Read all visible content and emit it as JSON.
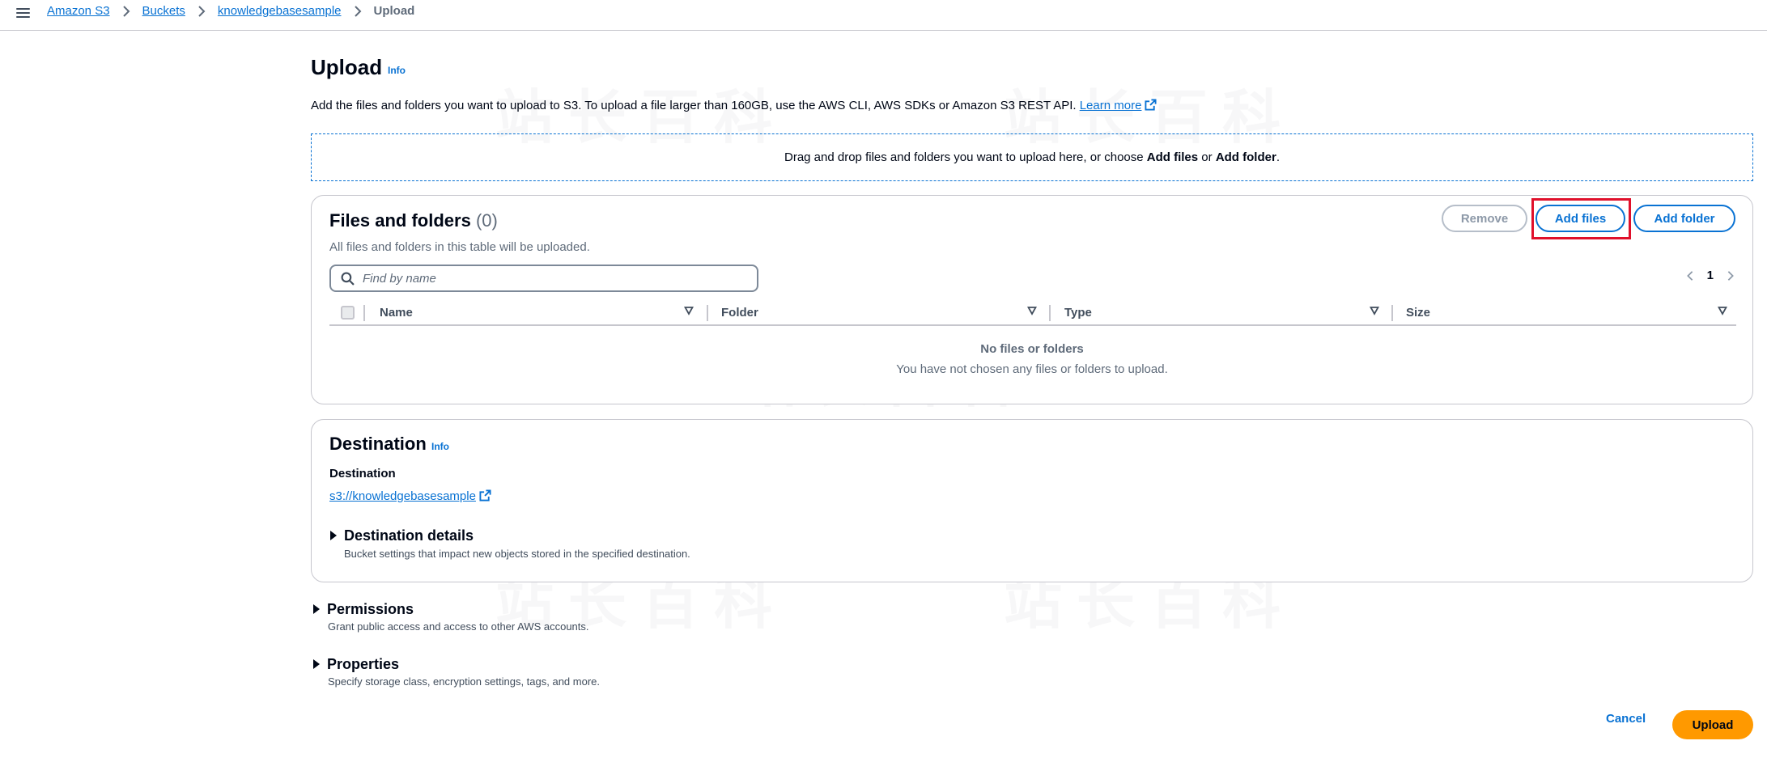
{
  "breadcrumb": {
    "items": [
      "Amazon S3",
      "Buckets",
      "knowledgebasesample"
    ],
    "current": "Upload"
  },
  "page": {
    "title": "Upload",
    "info": "Info",
    "description": "Add the files and folders you want to upload to S3. To upload a file larger than 160GB, use the AWS CLI, AWS SDKs or Amazon S3 REST API.",
    "learn_more": "Learn more"
  },
  "dropzone": {
    "text_before": "Drag and drop files and folders you want to upload here, or choose ",
    "add_files": "Add files",
    "or": " or ",
    "add_folder": "Add folder",
    "end": "."
  },
  "files": {
    "title": "Files and folders",
    "count": "(0)",
    "subtitle": "All files and folders in this table will be uploaded.",
    "remove_label": "Remove",
    "add_files_label": "Add files",
    "add_folder_label": "Add folder",
    "search_placeholder": "Find by name",
    "page": "1",
    "columns": [
      "Name",
      "Folder",
      "Type",
      "Size"
    ],
    "empty_title": "No files or folders",
    "empty_subtitle": "You have not chosen any files or folders to upload."
  },
  "destination": {
    "title": "Destination",
    "info": "Info",
    "label": "Destination",
    "link": "s3://knowledgebasesample",
    "details_title": "Destination details",
    "details_desc": "Bucket settings that impact new objects stored in the specified destination."
  },
  "permissions": {
    "title": "Permissions",
    "desc": "Grant public access and access to other AWS accounts."
  },
  "properties": {
    "title": "Properties",
    "desc": "Specify storage class, encryption settings, tags, and more."
  },
  "footer": {
    "cancel": "Cancel",
    "upload": "Upload"
  },
  "watermark": "站长百科",
  "colors": {
    "link": "#0972d3",
    "primary": "#ff9900",
    "highlight": "#e0102b"
  }
}
